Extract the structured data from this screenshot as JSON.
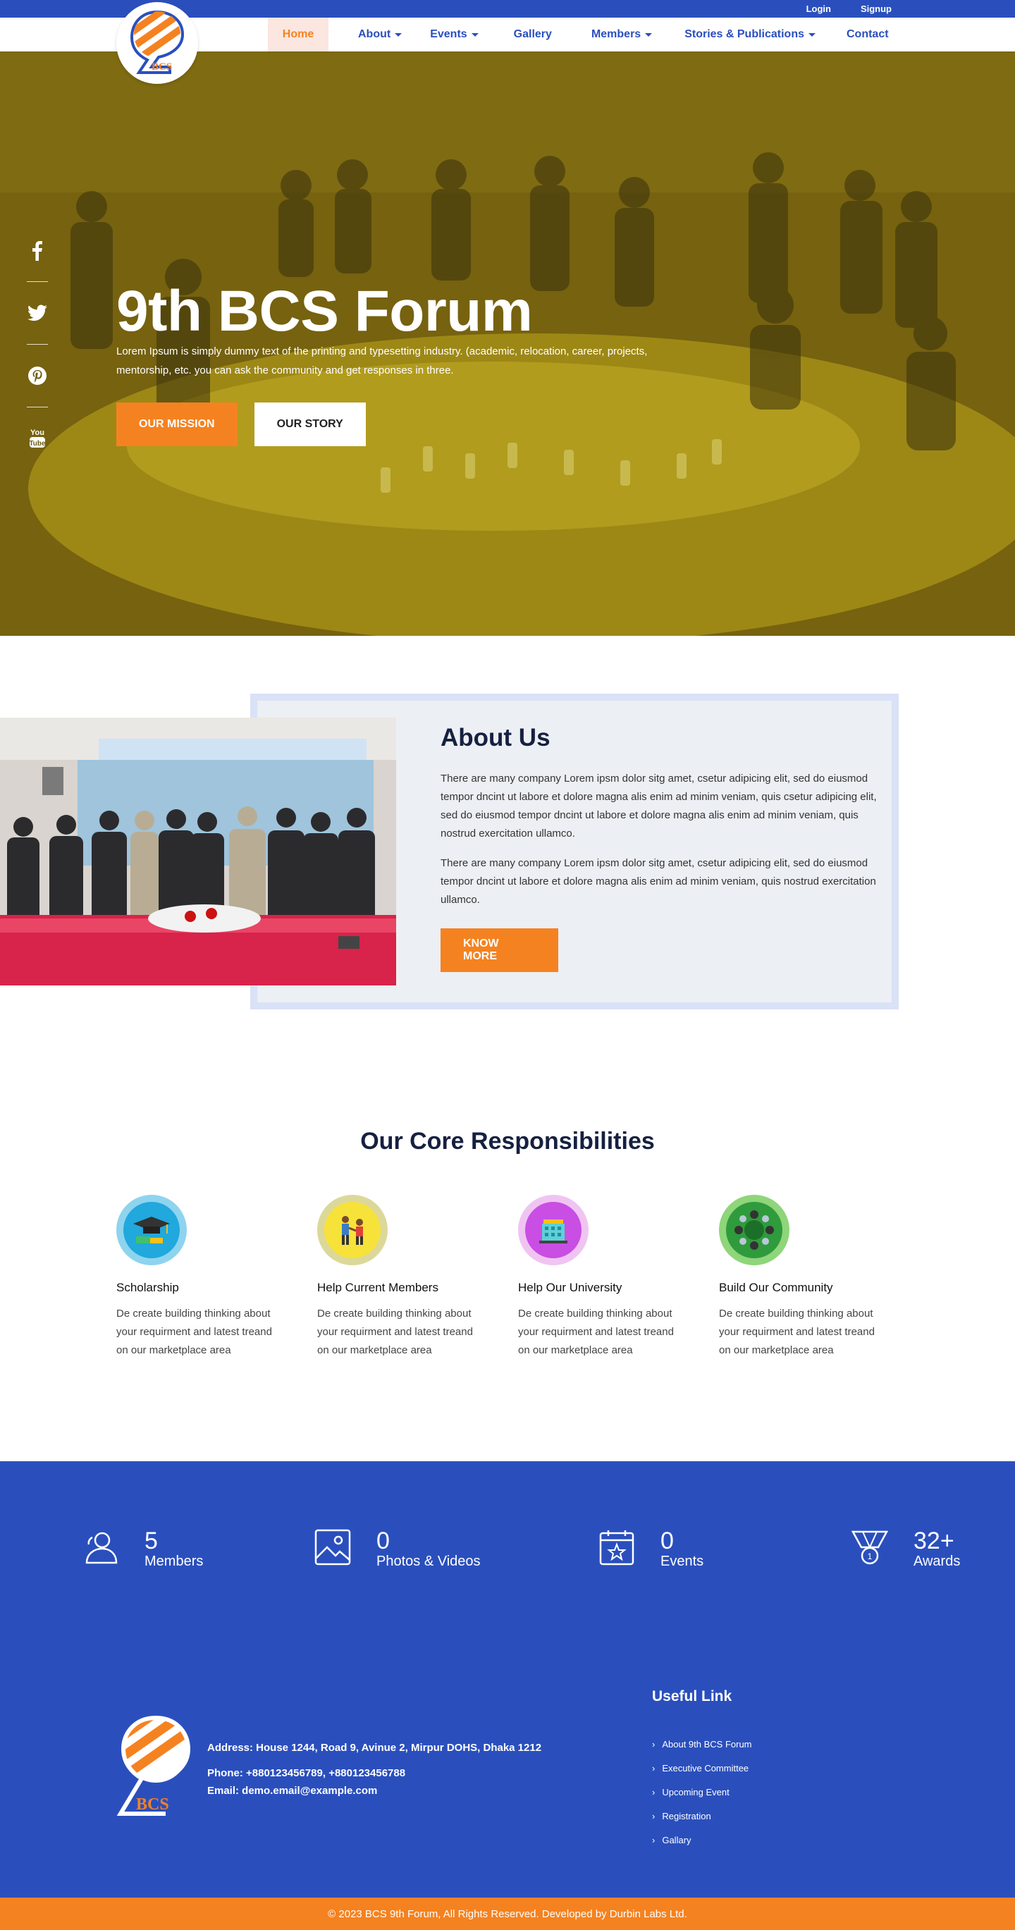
{
  "topbar": {
    "login": "Login",
    "signup": "Signup"
  },
  "nav": {
    "items": [
      {
        "label": "Home",
        "active": true,
        "dropdown": false
      },
      {
        "label": "About",
        "active": false,
        "dropdown": true
      },
      {
        "label": "Events",
        "active": false,
        "dropdown": true
      },
      {
        "label": "Gallery",
        "active": false,
        "dropdown": false
      },
      {
        "label": "Members",
        "active": false,
        "dropdown": true
      },
      {
        "label": "Stories & Publications",
        "active": false,
        "dropdown": true
      },
      {
        "label": "Contact",
        "active": false,
        "dropdown": false
      }
    ]
  },
  "logo": {
    "text": "BCS"
  },
  "hero": {
    "title": "9th BCS Forum",
    "text": "Lorem Ipsum is simply dummy text of the printing and typesetting industry. (academic, relocation, career, projects, mentorship, etc. you can ask the community and get responses in three.",
    "mission_button": "OUR MISSION",
    "story_button": "OUR STORY",
    "social": [
      "facebook-icon",
      "twitter-icon",
      "pinterest-icon",
      "youtube-icon"
    ]
  },
  "about": {
    "title": "About Us",
    "p1": "There are many company Lorem ipsm dolor sitg amet, csetur adipicing elit, sed do eiusmod tempor dncint ut labore et dolore magna alis enim ad minim veniam, quis csetur adipicing elit, sed do eiusmod tempor dncint ut labore et dolore magna alis enim ad minim veniam, quis nostrud exercitation ullamco.",
    "p2": "There are many company Lorem ipsm dolor sitg amet, csetur adipicing elit, sed do eiusmod tempor dncint ut labore et dolore magna alis enim ad minim veniam, quis nostrud exercitation ullamco.",
    "button": "KNOW MORE"
  },
  "core": {
    "title": "Our Core Responsibilities",
    "cards": [
      {
        "title": "Scholarship",
        "text": "De create building thinking about your requirment and latest treand on our marketplace area",
        "icon": "graduation-icon"
      },
      {
        "title": "Help Current Members",
        "text": "De create building thinking about your requirment and latest treand on our marketplace area",
        "icon": "helping-hand-icon"
      },
      {
        "title": "Help Our University",
        "text": "De create building thinking about your requirment and latest treand on our marketplace area",
        "icon": "university-icon"
      },
      {
        "title": "Build Our Community",
        "text": "De create building thinking about your requirment and latest treand on our marketplace area",
        "icon": "community-icon"
      }
    ]
  },
  "stats": [
    {
      "value": "5",
      "label": "Members",
      "icon": "user-icon"
    },
    {
      "value": "0",
      "label": "Photos & Videos",
      "icon": "image-icon"
    },
    {
      "value": "0",
      "label": "Events",
      "icon": "calendar-star-icon"
    },
    {
      "value": "32+",
      "label": "Awards",
      "icon": "medal-icon"
    }
  ],
  "footer": {
    "address": "Address: House 1244, Road 9, Avinue 2, Mirpur DOHS, Dhaka 1212",
    "phone": "Phone: +880123456789, +880123456788",
    "email": "Email: demo.email@example.com",
    "useful_title": "Useful Link",
    "links": [
      "About 9th BCS Forum",
      "Executive Committee",
      "Upcoming Event",
      "Registration",
      "Gallary"
    ],
    "copyright": "© 2023 BCS 9th Forum, All Rights Reserved. Developed by Durbin Labs Ltd."
  },
  "colors": {
    "primary": "#2a4fbd",
    "accent": "#f58220",
    "dark": "#162040"
  }
}
